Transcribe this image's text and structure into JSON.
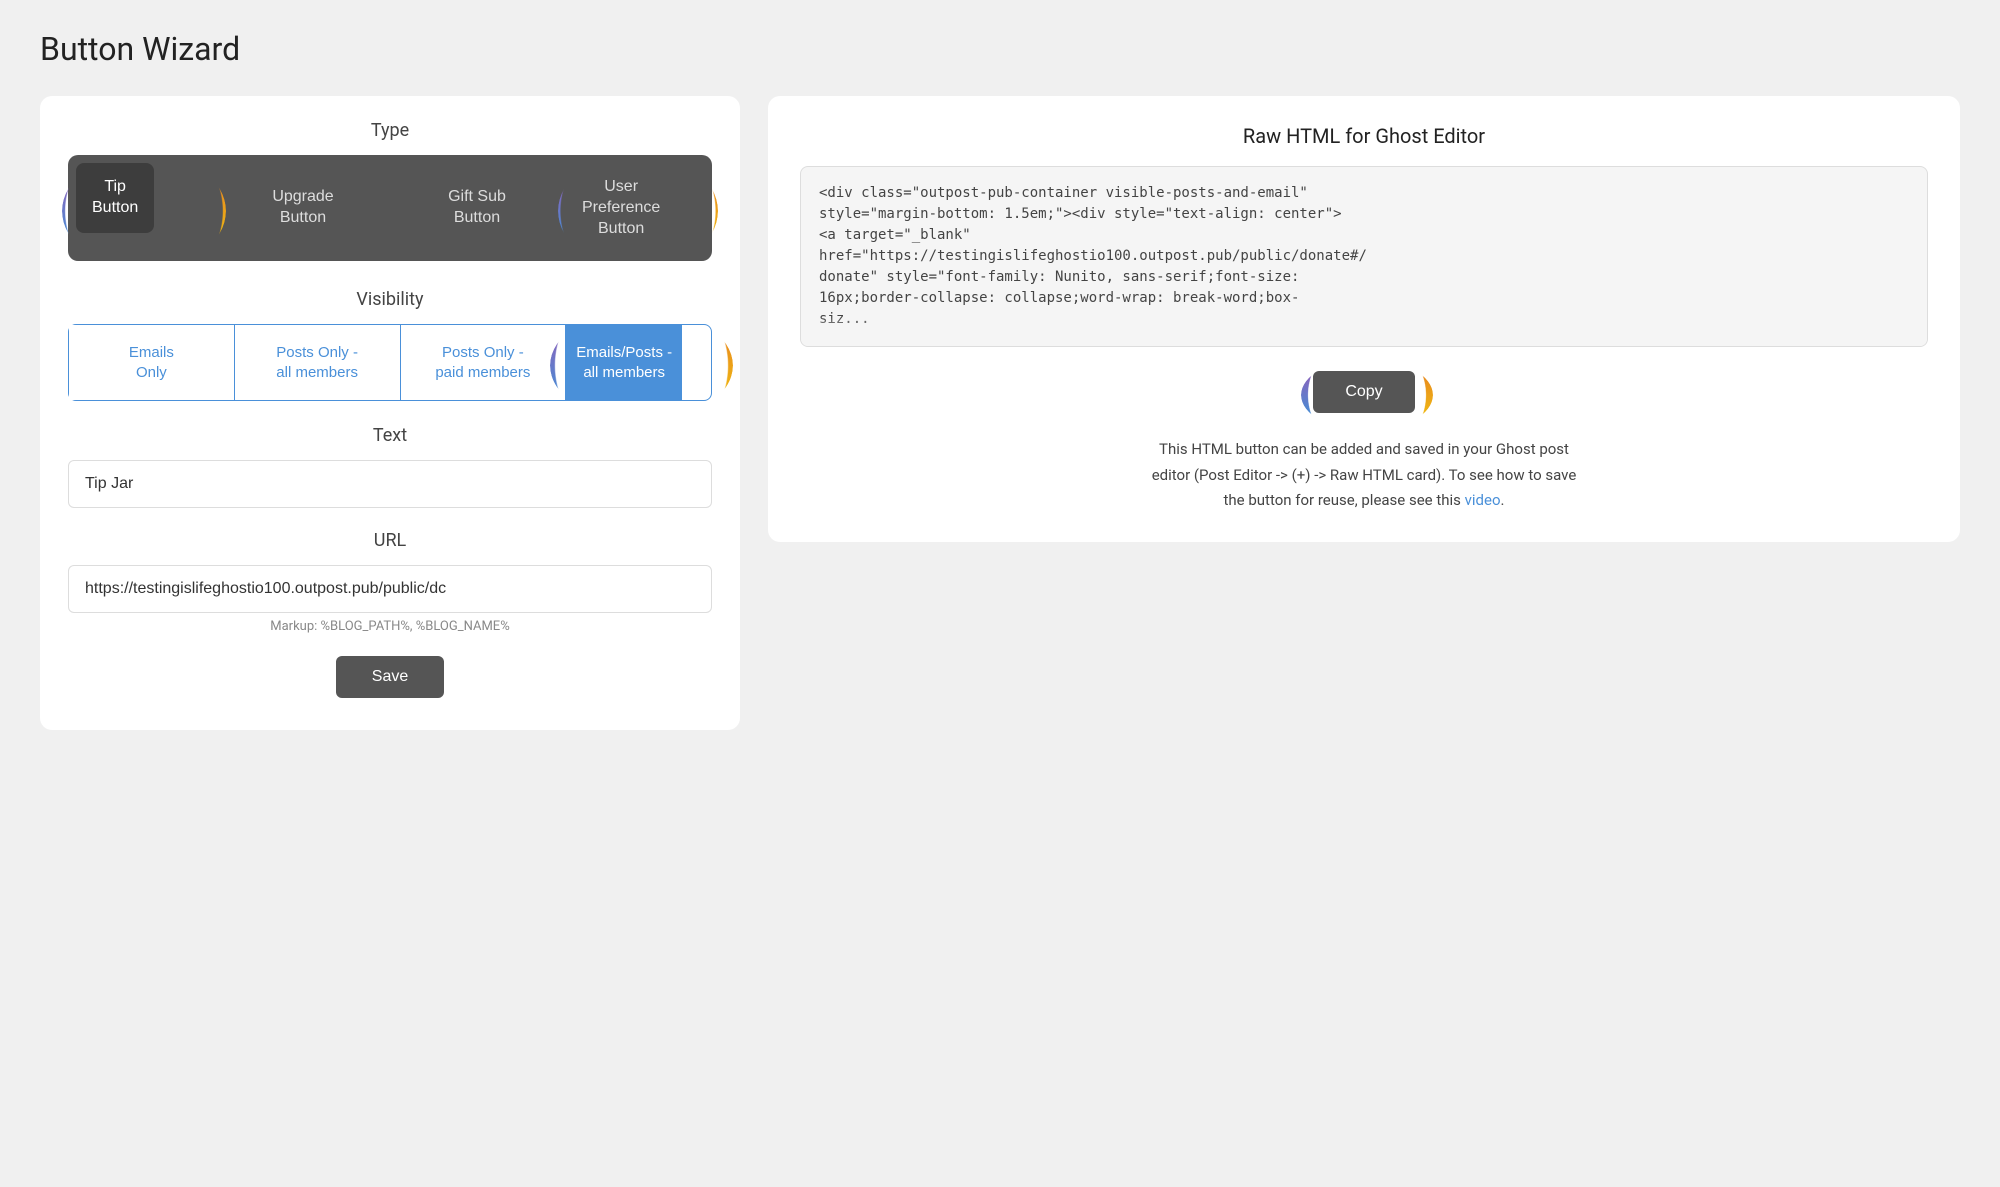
{
  "page": {
    "title": "Button Wizard"
  },
  "left_panel": {
    "type_section": {
      "label": "Type",
      "buttons": [
        {
          "id": "tip",
          "label": "Tip\nButton",
          "active": true,
          "circled": true
        },
        {
          "id": "upgrade",
          "label": "Upgrade\nButton",
          "active": false
        },
        {
          "id": "gift",
          "label": "Gift Sub\nButton",
          "active": false
        },
        {
          "id": "user-pref",
          "label": "User\nPreference\nButton",
          "active": false,
          "circled": true
        }
      ]
    },
    "visibility_section": {
      "label": "Visibility",
      "buttons": [
        {
          "id": "emails-only",
          "label": "Emails\nOnly",
          "active": false
        },
        {
          "id": "posts-all",
          "label": "Posts Only -\nall members",
          "active": false
        },
        {
          "id": "posts-paid",
          "label": "Posts Only -\npaid members",
          "active": false
        },
        {
          "id": "emails-posts-all",
          "label": "Emails/Posts -\nall members",
          "active": true,
          "circled": true
        }
      ]
    },
    "text_section": {
      "label": "Text",
      "value": "Tip Jar",
      "placeholder": "Tip Jar"
    },
    "url_section": {
      "label": "URL",
      "value": "https://testingislifeghostio100.outpost.pub/public/dc",
      "placeholder": ""
    },
    "markup_hint": "Markup: %BLOG_PATH%, %BLOG_NAME%",
    "save_button_label": "Save"
  },
  "right_panel": {
    "title": "Raw HTML for Ghost Editor",
    "html_code": "<div class=\"outpost-pub-container visible-posts-and-email\"\nstyle=\"margin-bottom: 1.5em;\"><div style=\"text-align: center\">\n<a target=\"_blank\"\nhref=\"https://testingislifeghostio100.outpost.pub/public/donate#/\ndonate\" style=\"font-family: Nunito, sans-serif;font-size:\n16px;border-collapse: collapse;word-wrap: break-word;box-\nsiz...",
    "copy_button_label": "Copy",
    "instructions": "This HTML button can be added and saved in your Ghost post\neditor (Post Editor -> (+) -> Raw HTML card). To see how to save\nthe button for reuse, please see this",
    "video_link_label": "video",
    "instructions_end": "."
  }
}
